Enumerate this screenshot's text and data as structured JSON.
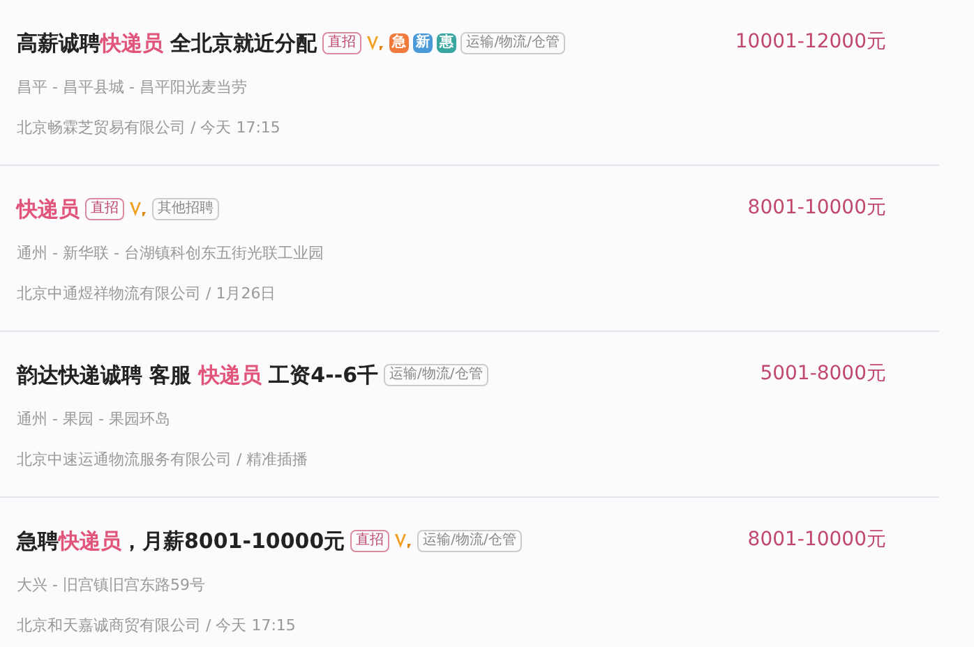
{
  "jobs": [
    {
      "title": [
        {
          "text": "高薪诚聘",
          "highlight": false
        },
        {
          "text": "快递员",
          "highlight": true
        },
        {
          "text": " 全北京就近分配",
          "highlight": false
        }
      ],
      "tags": [
        {
          "kind": "direct",
          "label": "直招"
        },
        {
          "kind": "verified"
        },
        {
          "kind": "urgent",
          "label": "急"
        },
        {
          "kind": "new",
          "label": "新"
        },
        {
          "kind": "perk",
          "label": "惠"
        },
        {
          "kind": "category",
          "label": "运输/物流/仓管"
        }
      ],
      "location": "昌平 - 昌平县城 - 昌平阳光麦当劳",
      "company": "北京畅霖芝贸易有限公司 / 今天 17:15",
      "salary": "10001-12000元"
    },
    {
      "title": [
        {
          "text": "快递员",
          "highlight": true
        }
      ],
      "tags": [
        {
          "kind": "direct",
          "label": "直招"
        },
        {
          "kind": "verified"
        },
        {
          "kind": "category",
          "label": "其他招聘"
        }
      ],
      "location": "通州 - 新华联 - 台湖镇科创东五街光联工业园",
      "company": "北京中通煜祥物流有限公司 / 1月26日",
      "salary": "8001-10000元"
    },
    {
      "title": [
        {
          "text": "韵达快递诚聘 客服 ",
          "highlight": false
        },
        {
          "text": "快递员",
          "highlight": true
        },
        {
          "text": " 工资4--6千",
          "highlight": false
        }
      ],
      "tags": [
        {
          "kind": "category",
          "label": "运输/物流/仓管"
        }
      ],
      "location": "通州 - 果园 - 果园环岛",
      "company": "北京中速运通物流服务有限公司 / 精准插播",
      "salary": "5001-8000元"
    },
    {
      "title": [
        {
          "text": "急聘",
          "highlight": false
        },
        {
          "text": "快递员",
          "highlight": true
        },
        {
          "text": "，月薪8001-10000元",
          "highlight": false
        }
      ],
      "tags": [
        {
          "kind": "direct",
          "label": "直招"
        },
        {
          "kind": "verified"
        },
        {
          "kind": "category",
          "label": "运输/物流/仓管"
        }
      ],
      "location": "大兴 - 旧宫镇旧宫东路59号",
      "company": "北京和天嘉诚商贸有限公司 / 今天 17:15",
      "salary": "8001-10000元"
    }
  ]
}
